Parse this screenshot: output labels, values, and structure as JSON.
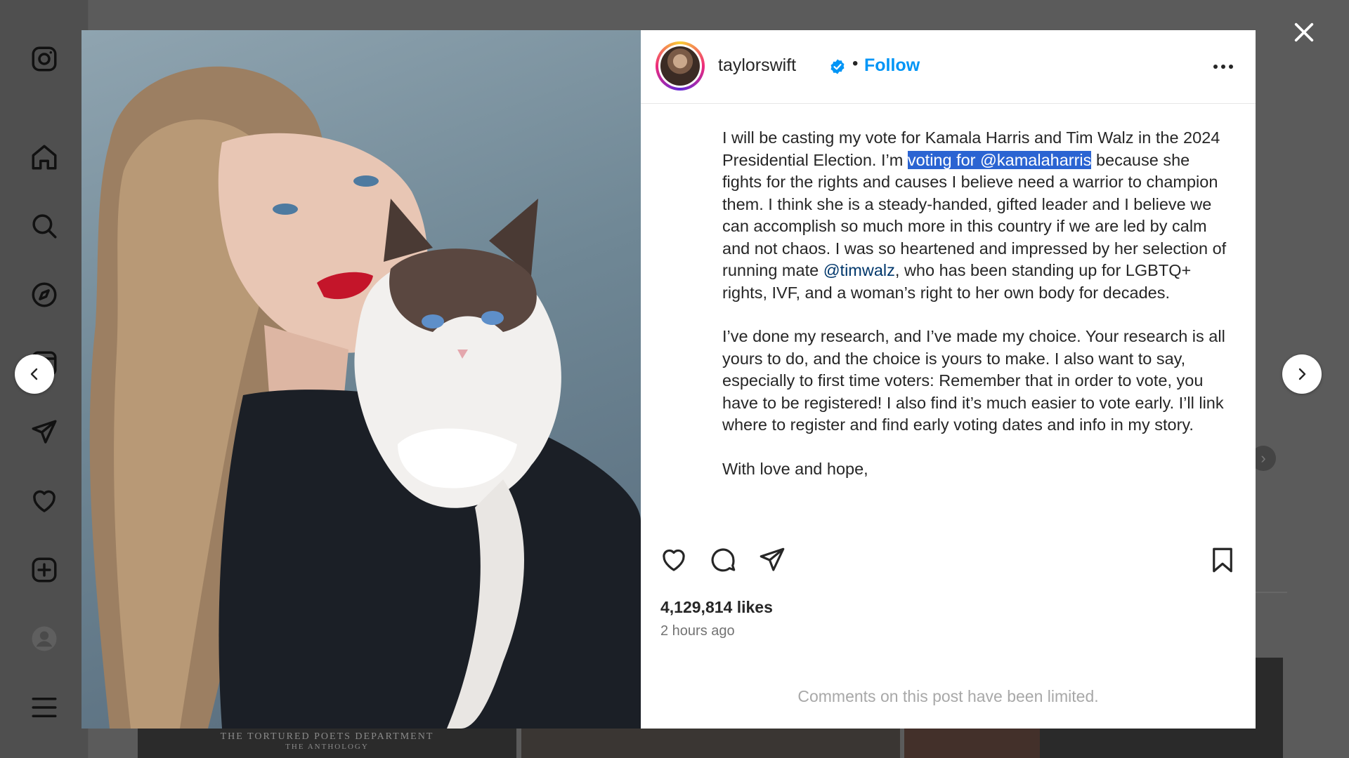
{
  "sidebar": {
    "items": [
      {
        "name": "instagram-logo-icon"
      },
      {
        "name": "home-icon"
      },
      {
        "name": "search-icon"
      },
      {
        "name": "explore-icon"
      },
      {
        "name": "reels-icon"
      },
      {
        "name": "messages-icon"
      },
      {
        "name": "notifications-icon"
      },
      {
        "name": "create-icon"
      },
      {
        "name": "profile-icon"
      },
      {
        "name": "more-menu-icon"
      }
    ]
  },
  "background": {
    "thumb_title_line1": "THE TORTURED POETS DEPARTMENT",
    "thumb_title_line2": "THE ANTHOLOGY"
  },
  "post": {
    "username": "taylorswift",
    "verified": true,
    "separator": "•",
    "follow_label": "Follow",
    "more_label": "•••",
    "caption": {
      "p1_part1": "I will be casting my vote for Kamala Harris and Tim Walz in the 2024 Presidential Election. I’m ",
      "p1_highlight": "voting for @kamalaharris",
      "p1_part2": " because she fights for the rights and causes I believe need a warrior to champion them. I think she is a steady-handed, gifted leader and I believe we can accomplish so much more in this country if we are led by calm and not chaos. I was so heartened and impressed by her selection of running mate ",
      "p1_mention": "@timwalz",
      "p1_part3": ", who has been standing up for LGBTQ+ rights, IVF, and a woman’s right to her own body for decades.",
      "p2": "I’ve done my research, and I’ve made my choice. Your research is all yours to do, and the choice is yours to make. I also want to say, especially to first time voters: Remember that in order to vote, you have to be registered! I also find it’s much easier to vote early. I’ll link where to register and find early voting dates and info in my story.",
      "p3": "With love and hope,"
    },
    "likes": "4,129,814 likes",
    "time_ago": "2 hours ago",
    "comments_limited": "Comments on this post have been limited."
  },
  "colors": {
    "accent": "#0095f6",
    "mention": "#00376b",
    "selection": "#2b64d2",
    "overlay": "#5b5b5b"
  }
}
